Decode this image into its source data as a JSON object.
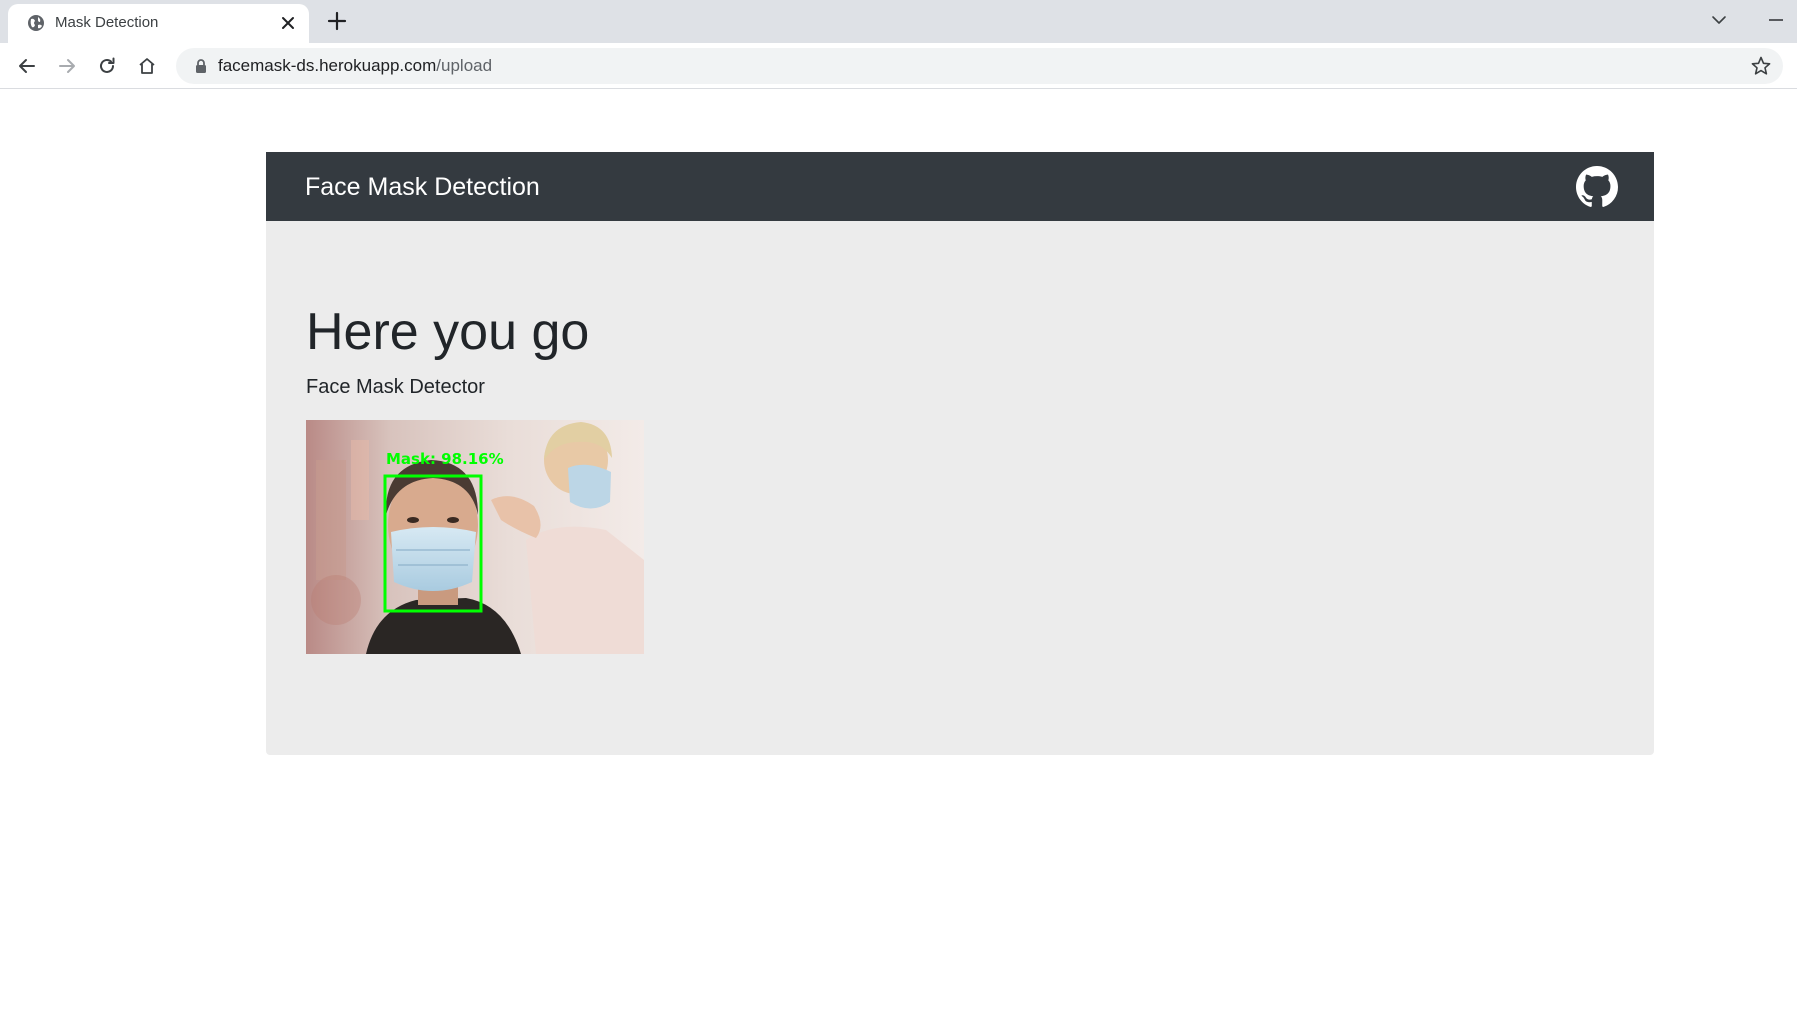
{
  "browser": {
    "tab": {
      "title": "Mask Detection",
      "favicon": "globe-icon"
    },
    "address_bar": {
      "host": "facemask-ds.herokuapp.com",
      "path": "/upload"
    },
    "icons": {
      "close": "close-icon",
      "new_tab": "plus-icon",
      "tab_search": "chevron-down-icon",
      "minimize": "minimize-icon",
      "back": "arrow-left-icon",
      "forward": "arrow-right-icon",
      "reload": "reload-icon",
      "home": "home-icon",
      "lock": "lock-icon",
      "bookmark": "star-icon"
    }
  },
  "navbar": {
    "brand": "Face Mask Detection",
    "github_icon": "github-icon"
  },
  "main": {
    "heading": "Here you go",
    "subheading": "Face Mask Detector",
    "result": {
      "label": "Mask: 98.16%",
      "box_color": "#00ff00"
    }
  },
  "colors": {
    "navbar_bg": "#343a40",
    "jumbotron_bg": "#ececec",
    "text": "#212529"
  }
}
